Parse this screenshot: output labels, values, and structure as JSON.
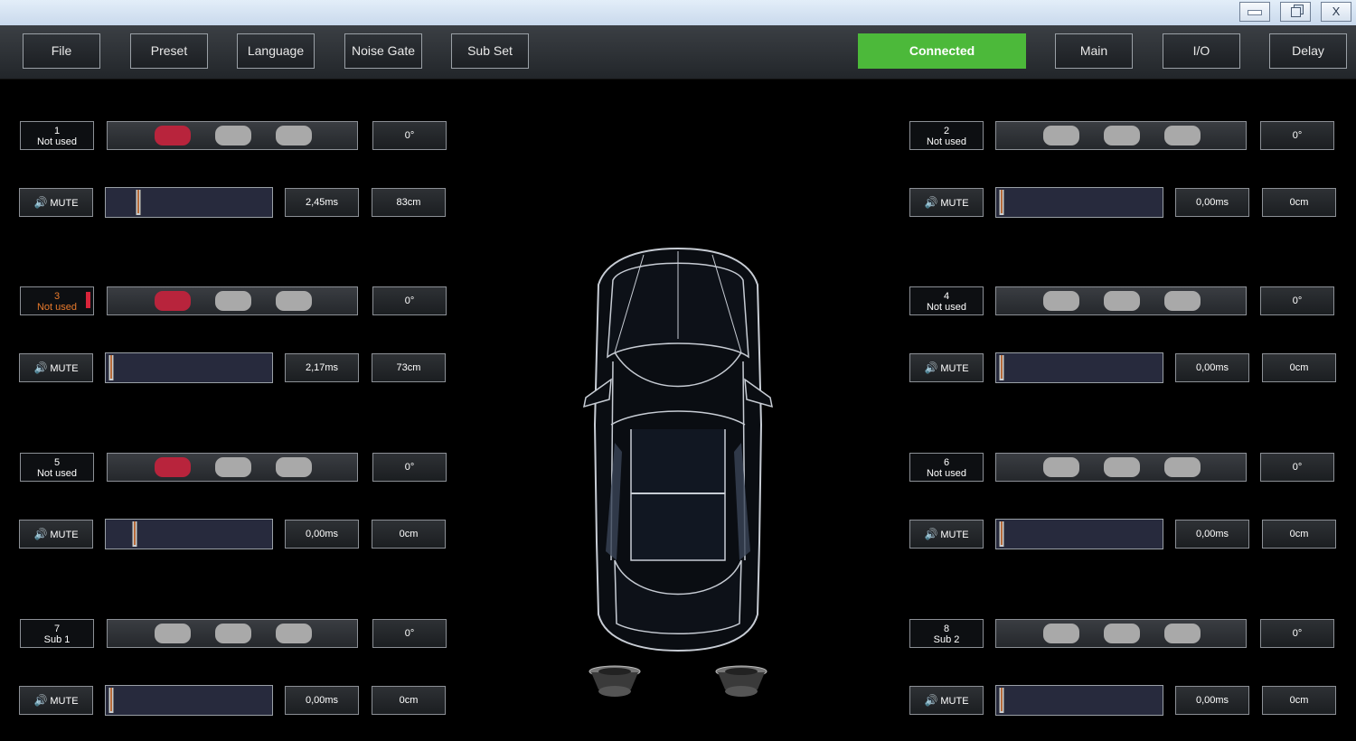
{
  "window": {
    "minimize_icon": "minimize-icon",
    "restore_icon": "restore-icon",
    "close_label": "X"
  },
  "menu": {
    "file": "File",
    "preset": "Preset",
    "language": "Language",
    "noise_gate": "Noise Gate",
    "sub_set": "Sub Set",
    "status": "Connected",
    "main": "Main",
    "io": "I/O",
    "delay": "Delay"
  },
  "colors": {
    "connected": "#4cb93a",
    "selected_pill": "#b8243c",
    "active_channel_text": "#e87a2c"
  },
  "mute_label": "MUTE",
  "channels": [
    {
      "num": "1",
      "name": "Not used",
      "active": false,
      "phase": "0°",
      "delay": "2,45ms",
      "distance": "83cm",
      "selected_pill": 1
    },
    {
      "num": "2",
      "name": "Not used",
      "active": false,
      "phase": "0°",
      "delay": "0,00ms",
      "distance": "0cm",
      "selected_pill": 0
    },
    {
      "num": "3",
      "name": "Not used",
      "active": true,
      "phase": "0°",
      "delay": "2,17ms",
      "distance": "73cm",
      "selected_pill": 1
    },
    {
      "num": "4",
      "name": "Not used",
      "active": false,
      "phase": "0°",
      "delay": "0,00ms",
      "distance": "0cm",
      "selected_pill": 0
    },
    {
      "num": "5",
      "name": "Not used",
      "active": false,
      "phase": "0°",
      "delay": "0,00ms",
      "distance": "0cm",
      "selected_pill": 1
    },
    {
      "num": "6",
      "name": "Not used",
      "active": false,
      "phase": "0°",
      "delay": "0,00ms",
      "distance": "0cm",
      "selected_pill": 0
    },
    {
      "num": "7",
      "name": "Sub 1",
      "active": false,
      "phase": "0°",
      "delay": "0,00ms",
      "distance": "0cm",
      "selected_pill": 0
    },
    {
      "num": "8",
      "name": "Sub 2",
      "active": false,
      "phase": "0°",
      "delay": "0,00ms",
      "distance": "0cm",
      "selected_pill": 0
    }
  ]
}
